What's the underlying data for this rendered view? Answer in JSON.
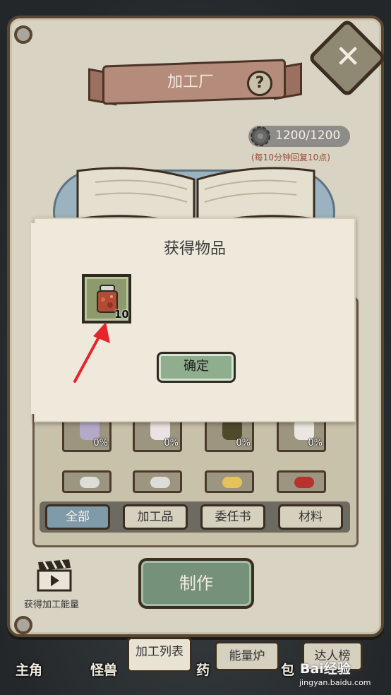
{
  "header": {
    "title": "加工厂",
    "close_icon": "close-icon",
    "help_icon": "question-icon"
  },
  "energy": {
    "value": "1200/1200",
    "note": "(每10分钟回复10点)",
    "icon": "gear-icon"
  },
  "modal": {
    "title": "获得物品",
    "reward": {
      "icon": "jar-icon",
      "quantity": "10"
    },
    "confirm_label": "确定"
  },
  "item_slots": [
    {
      "percent": "0%",
      "icon": "perfume-bottle-icon"
    },
    {
      "percent": "0%",
      "icon": "lotion-bottle-icon"
    },
    {
      "percent": "0%",
      "icon": "dark-jar-icon"
    },
    {
      "percent": "0%",
      "icon": "white-cloth-icon"
    },
    {
      "icon": "jar-lid-icon"
    },
    {
      "icon": "jar-lid-icon"
    },
    {
      "icon": "cheese-icon"
    },
    {
      "icon": "red-box-icon"
    }
  ],
  "filters": {
    "all": "全部",
    "processed": "加工品",
    "commission": "委任书",
    "materials": "材料"
  },
  "make_label": "制作",
  "video_reward_label": "获得加工能量",
  "bottom_nav": {
    "hero": "主角",
    "monster": "怪兽",
    "potion_label": "药",
    "bag_label": "包",
    "tabs": {
      "process_list": "加工列表",
      "energy_furnace": "能量炉",
      "leaderboard": "达人榜"
    }
  },
  "watermark": {
    "logo": "Bai经验",
    "url": "jingyan.baidu.com"
  },
  "colors": {
    "accent_green": "#76917a",
    "arrow_red": "#e5252b",
    "border_brown": "#3b2d1f"
  }
}
